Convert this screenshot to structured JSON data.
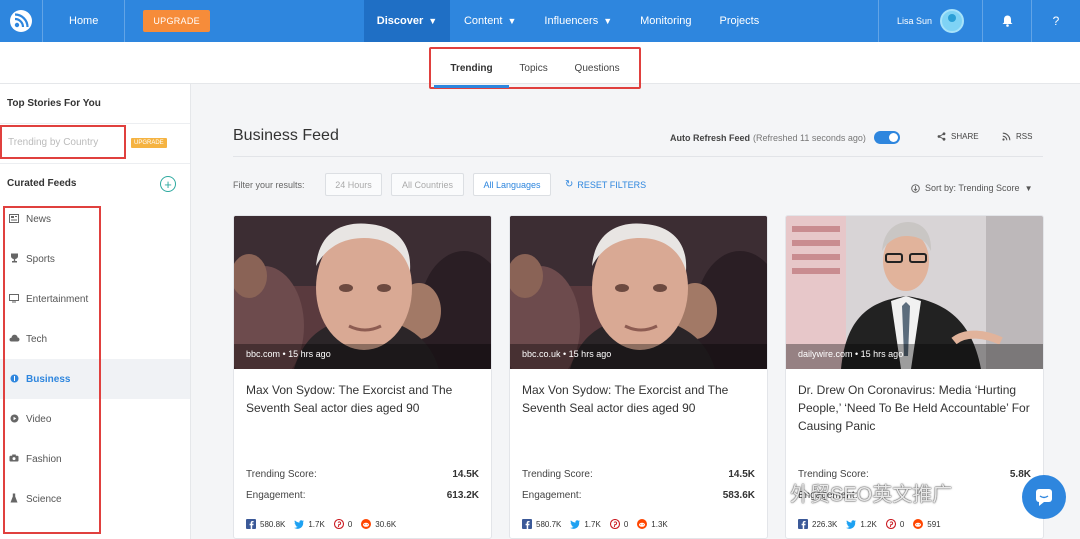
{
  "topnav": {
    "home": "Home",
    "upgrade": "UPGRADE",
    "discover": "Discover",
    "content": "Content",
    "influencers": "Influencers",
    "monitoring": "Monitoring",
    "projects": "Projects",
    "user_name": "Lisa Sun",
    "help": "?"
  },
  "subnav": {
    "tabs": [
      "Trending",
      "Topics",
      "Questions"
    ],
    "active": "Trending"
  },
  "sidebar": {
    "top_stories": "Top Stories For You",
    "trending_by_country": "Trending by Country",
    "upgrade_badge": "UPGRADE",
    "curated_feeds": "Curated Feeds",
    "add": "+",
    "feeds": [
      {
        "label": "News",
        "icon": "newspaper-icon"
      },
      {
        "label": "Sports",
        "icon": "trophy-icon"
      },
      {
        "label": "Entertainment",
        "icon": "tv-icon"
      },
      {
        "label": "Tech",
        "icon": "cloud-icon"
      },
      {
        "label": "Business",
        "icon": "business-icon"
      },
      {
        "label": "Video",
        "icon": "play-icon"
      },
      {
        "label": "Fashion",
        "icon": "camera-icon"
      },
      {
        "label": "Science",
        "icon": "flask-icon"
      }
    ],
    "active_feed": "Business"
  },
  "main": {
    "title": "Business Feed",
    "auto_refresh_label": "Auto Refresh Feed",
    "auto_refresh_status": "(Refreshed 11 seconds ago)",
    "share": "SHARE",
    "rss": "RSS",
    "filter_label": "Filter your results:",
    "filters": [
      "24 Hours",
      "All Countries",
      "All Languages"
    ],
    "reset": "RESET FILTERS",
    "sort": "Sort by: Trending Score"
  },
  "cards": [
    {
      "source": "bbc.com • 15 hrs ago",
      "title": "Max Von Sydow: The Exorcist and The Seventh Seal actor dies aged 90",
      "trending_label": "Trending Score:",
      "trending": "14.5K",
      "engagement_label": "Engagement:",
      "engagement": "613.2K",
      "facebook": "580.8K",
      "twitter": "1.7K",
      "pinterest": "0",
      "reddit": "30.6K"
    },
    {
      "source": "bbc.co.uk • 15 hrs ago",
      "title": "Max Von Sydow: The Exorcist and The Seventh Seal actor dies aged 90",
      "trending_label": "Trending Score:",
      "trending": "14.5K",
      "engagement_label": "Engagement:",
      "engagement": "583.6K",
      "facebook": "580.7K",
      "twitter": "1.7K",
      "pinterest": "0",
      "reddit": "1.3K"
    },
    {
      "source": "dailywire.com • 15 hrs ago",
      "title": "Dr. Drew On Coronavirus: Media ‘Hurting People,’ ‘Need To Be Held Accountable’ For Causing Panic",
      "trending_label": "Trending Score:",
      "trending": "5.8K",
      "engagement_label": "Engagement:",
      "engagement": "",
      "facebook": "226.3K",
      "twitter": "1.2K",
      "pinterest": "0",
      "reddit": "591"
    }
  ],
  "watermark": "外贸SEO英文推广",
  "colors": {
    "brand": "#2e86de",
    "upgrade": "#f68c3a",
    "highlight": "#e0403e"
  }
}
